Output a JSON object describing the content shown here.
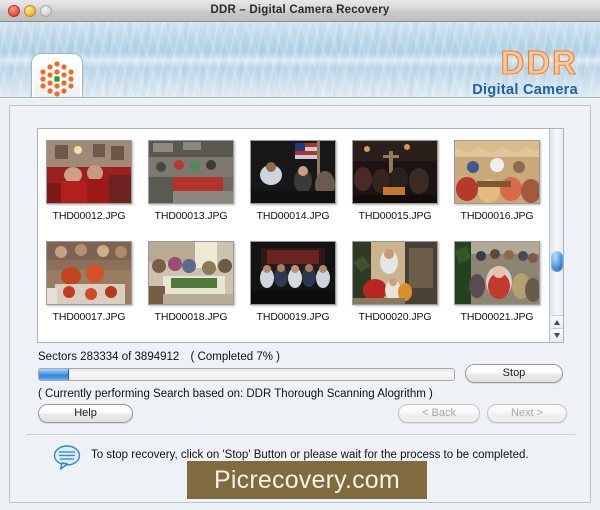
{
  "window": {
    "title": "DDR – Digital Camera Recovery",
    "traffic_lights": [
      "close",
      "minimize",
      "zoom"
    ]
  },
  "banner": {
    "app_icon_name": "flower-checker-icon",
    "brand_title": "DDR",
    "brand_subtitle": "Digital Camera",
    "brand_color": "#f07d22",
    "subtitle_color": "#1d5fa8"
  },
  "thumbnails": {
    "rows": [
      [
        {
          "label": "THD00012.JPG",
          "scene": "red-dress-group"
        },
        {
          "label": "THD00013.JPG",
          "scene": "hall-tables"
        },
        {
          "label": "THD00014.JPG",
          "scene": "flag-ceremony"
        },
        {
          "label": "THD00015.JPG",
          "scene": "dark-crowd"
        },
        {
          "label": "THD00016.JPG",
          "scene": "banquet-table"
        }
      ],
      [
        {
          "label": "THD00017.JPG",
          "scene": "family-dinner"
        },
        {
          "label": "THD00018.JPG",
          "scene": "buffet-table"
        },
        {
          "label": "THD00019.JPG",
          "scene": "group-photo-stage"
        },
        {
          "label": "THD00020.JPG",
          "scene": "children-gifts"
        },
        {
          "label": "THD00021.JPG",
          "scene": "santa-group"
        }
      ]
    ]
  },
  "scrollbar": {
    "thumb_position_pct": 77,
    "up_arrow": "scroll-up-arrow",
    "down_arrow": "scroll-down-arrow"
  },
  "status": {
    "sectors_text": "Sectors 283334 of 3894912",
    "completed_text": "( Completed 7% )",
    "progress_percent": 7,
    "search_note": "( Currently performing Search based on: DDR Thorough Scanning Alogrithm )"
  },
  "buttons": {
    "stop": {
      "label": "Stop",
      "disabled": false
    },
    "help": {
      "label": "Help",
      "disabled": false
    },
    "back": {
      "label": "< Back",
      "disabled": true
    },
    "next": {
      "label": "Next >",
      "disabled": true
    }
  },
  "message": {
    "icon": "speech-bubble-icon",
    "text": "To stop recovery, click on 'Stop' Button or please wait for the process to be completed."
  },
  "watermark": {
    "text": "Picrecovery.com",
    "background": "#7f6b3e"
  }
}
